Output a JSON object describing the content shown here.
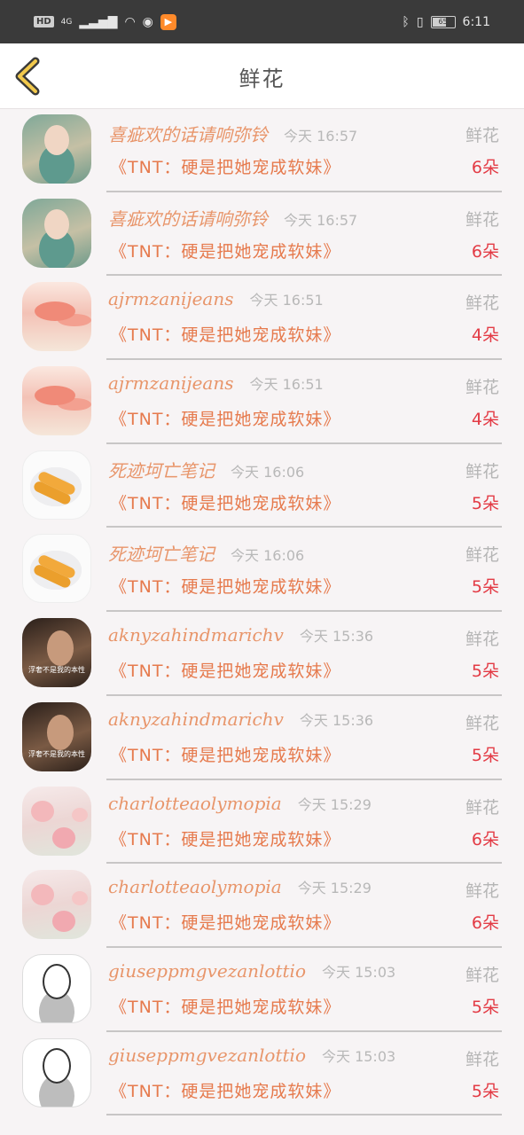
{
  "status_bar": {
    "network_label": "HD",
    "network_type": "4G",
    "battery": "65",
    "time": "6:11"
  },
  "header": {
    "title": "鲜花"
  },
  "items": [
    {
      "name": "喜疵欢的话请响弥铃",
      "time": "今天 16:57",
      "gift": "鲜花",
      "work": "《TNT：硬是把她宠成软妹》",
      "count": "6朵",
      "avatar": "woman-portrait"
    },
    {
      "name": "喜疵欢的话请响弥铃",
      "time": "今天 16:57",
      "gift": "鲜花",
      "work": "《TNT：硬是把她宠成软妹》",
      "count": "6朵",
      "avatar": "woman-portrait"
    },
    {
      "name": "ajrmzanijeans",
      "time": "今天 16:51",
      "gift": "鲜花",
      "work": "《TNT：硬是把她宠成软妹》",
      "count": "4朵",
      "avatar": "flowers"
    },
    {
      "name": "ajrmzanijeans",
      "time": "今天 16:51",
      "gift": "鲜花",
      "work": "《TNT：硬是把她宠成软妹》",
      "count": "4朵",
      "avatar": "flowers"
    },
    {
      "name": "死迹坷亡笔记",
      "time": "今天 16:06",
      "gift": "鲜花",
      "work": "《TNT：硬是把她宠成软妹》",
      "count": "5朵",
      "avatar": "food-plate"
    },
    {
      "name": "死迹坷亡笔记",
      "time": "今天 16:06",
      "gift": "鲜花",
      "work": "《TNT：硬是把她宠成软妹》",
      "count": "5朵",
      "avatar": "food-plate"
    },
    {
      "name": "aknyzahindmarichv",
      "time": "今天 15:36",
      "gift": "鲜花",
      "work": "《TNT：硬是把她宠成软妹》",
      "count": "5朵",
      "avatar": "portrait",
      "caption": "浮奢不是我的本性"
    },
    {
      "name": "aknyzahindmarichv",
      "time": "今天 15:36",
      "gift": "鲜花",
      "work": "《TNT：硬是把她宠成软妹》",
      "count": "5朵",
      "avatar": "portrait",
      "caption": "浮奢不是我的本性"
    },
    {
      "name": "charlotteaolymopia",
      "time": "今天 15:29",
      "gift": "鲜花",
      "work": "《TNT：硬是把她宠成软妹》",
      "count": "6朵",
      "avatar": "roses"
    },
    {
      "name": "charlotteaolymopia",
      "time": "今天 15:29",
      "gift": "鲜花",
      "work": "《TNT：硬是把她宠成软妹》",
      "count": "6朵",
      "avatar": "roses"
    },
    {
      "name": "giuseppmgvezanlottio",
      "time": "今天 15:03",
      "gift": "鲜花",
      "work": "《TNT：硬是把她宠成软妹》",
      "count": "5朵",
      "avatar": "sketch"
    },
    {
      "name": "giuseppmgvezanlottio",
      "time": "今天 15:03",
      "gift": "鲜花",
      "work": "《TNT：硬是把她宠成软妹》",
      "count": "5朵",
      "avatar": "sketch"
    }
  ]
}
